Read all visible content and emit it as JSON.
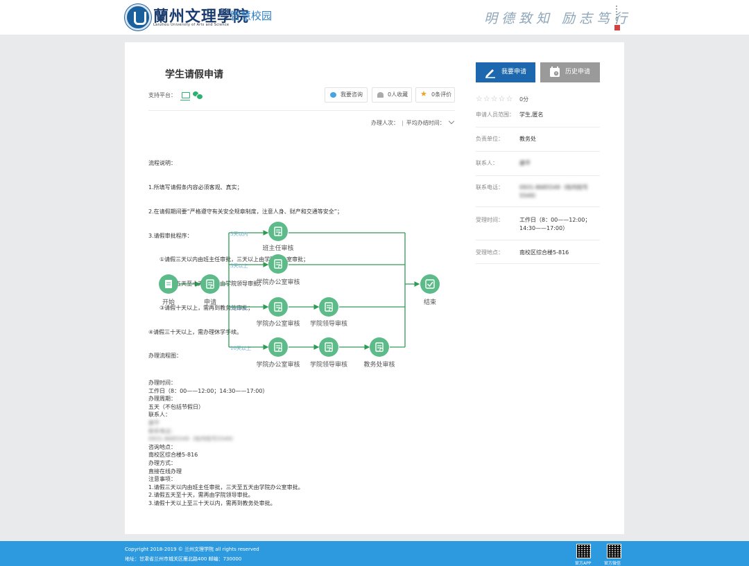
{
  "header": {
    "school_cn": "蘭州文理學院",
    "school_en": "Lanzhou University of Arts and Science",
    "brand": "智慧校园",
    "motto": "明德致知 励志笃行"
  },
  "title": "学生请假申请",
  "platform_label": "支持平台：",
  "actions": {
    "consult": "我要咨询",
    "favorite": "0人收藏",
    "review": "0条评价"
  },
  "stats": {
    "handle_count": "办理人次：",
    "avg_time": "平均办结时间："
  },
  "process_desc": [
    "流程说明：",
    "1.所填写请假条内容必须客观、真实；",
    "2.在请假期间要“严格遵守有关安全规章制度，注意人身、财产和交通等安全”；",
    "3.请假审批程序：",
    "①请假三天以内由班主任审批，三天以上由学院办公室审批；",
    "②请假五天至十天，需再由学院领导审批；",
    "③请假十天以上，需再到教务处审批；",
    "④请假三十天以上，需办理休学手续。",
    "办理流程图："
  ],
  "flow": {
    "start": "开始",
    "apply": "申请",
    "end": "结束",
    "branch1_label": "3天以内",
    "branch2_label": "3天以上",
    "branch3_label": "5天以上",
    "branch4_label": "10天以上",
    "node_class_teacher": "班主任审核",
    "node_office": "学院办公室审核",
    "node_office2": "学院办公室审核",
    "node_leader": "学院领导审核",
    "node_office3": "学院办公室审核",
    "node_leader2": "学院领导审核",
    "node_academic": "教务处审核"
  },
  "info": {
    "time_label": "办理时间：",
    "time_value": "工作日（8：00——12:00；14:30——17:00）",
    "period_label": "办理周期：",
    "period_value": "五天（不包括节假日）",
    "contact_label": "联系人：",
    "contact_value": "康平",
    "phone_label": "联系电话：",
    "phone_value": "0931-8685549（校内短号5549）",
    "location_label": "咨询地点：",
    "location_value": "南校区综合楼5-816",
    "mode_label": "办理方式：",
    "mode_value": "直接在线办理",
    "notes_label": "注意事项：",
    "notes": [
      "1.请假三天以内由班主任审批，三天至五天由学院办公室审批。",
      "2.请假五天至十天，需再由学院领导审批。",
      "3.请假十天以上至三十天以内，需再到教务处审批。"
    ]
  },
  "sidebar": {
    "apply_btn": "我要申请",
    "history_btn": "历史申请",
    "rating": "☆☆☆☆☆",
    "score": "0分",
    "rows": [
      {
        "k": "申请人员范围：",
        "v": "学生,匿名"
      },
      {
        "k": "负责单位：",
        "v": "教务处"
      },
      {
        "k": "联系人：",
        "v": "康平"
      },
      {
        "k": "联系电话：",
        "v": "0931-8685549（校内短号5549）"
      },
      {
        "k": "受理时间：",
        "v": "工作日（8：00——12:00；14:30——17:00）"
      },
      {
        "k": "受理地点：",
        "v": "南校区综合楼5-816"
      }
    ]
  },
  "footer": {
    "copyright": "Copyright 2018-2019 © 兰州文理学院 all rights reserved",
    "address": "地址：甘肃省兰州市城关区雁北路400 邮编：730000",
    "qr_app": "官方APP",
    "qr_wechat": "官方微信"
  },
  "colors": {
    "primary_blue": "#1c67ad",
    "footer_blue": "#2d9ae0",
    "flow_green": "#5dbb8a",
    "flow_line": "#2e9a54"
  }
}
